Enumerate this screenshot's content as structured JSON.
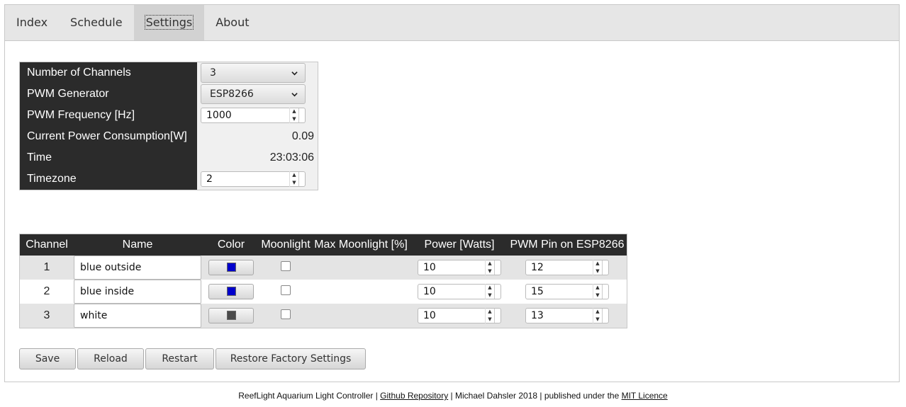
{
  "nav": {
    "tabs": [
      {
        "label": "Index"
      },
      {
        "label": "Schedule"
      },
      {
        "label": "Settings"
      },
      {
        "label": "About"
      }
    ]
  },
  "settings": {
    "rows": [
      {
        "label": "Number of Channels",
        "value": "3"
      },
      {
        "label": "PWM Generator",
        "value": "ESP8266"
      },
      {
        "label": "PWM Frequency [Hz]",
        "value": "1000"
      },
      {
        "label": "Current Power Consumption[W]",
        "value": "0.09"
      },
      {
        "label": "Time",
        "value": "23:03:06"
      },
      {
        "label": "Timezone",
        "value": "2"
      }
    ]
  },
  "channels": {
    "headers": [
      "Channel",
      "Name",
      "Color",
      "Moonlight",
      "Max Moonlight [%]",
      "Power [Watts]",
      "PWM Pin on ESP8266"
    ],
    "rows": [
      {
        "channel": "1",
        "name": "blue outside",
        "color": "#0000cc",
        "moonlight": false,
        "power": "10",
        "pin": "12"
      },
      {
        "channel": "2",
        "name": "blue inside",
        "color": "#0000cc",
        "moonlight": false,
        "power": "10",
        "pin": "15"
      },
      {
        "channel": "3",
        "name": "white",
        "color": "#4a4a4a",
        "moonlight": false,
        "power": "10",
        "pin": "13"
      }
    ]
  },
  "buttons": {
    "save": "Save",
    "reload": "Reload",
    "restart": "Restart",
    "restore": "Restore Factory Settings"
  },
  "footer": {
    "part1": "ReefLight Aquarium Light Controller | ",
    "repo_link": "Github Repository",
    "part2": " | Michael Dahsler 2018 | published under the ",
    "licence_link": "MIT Licence"
  }
}
